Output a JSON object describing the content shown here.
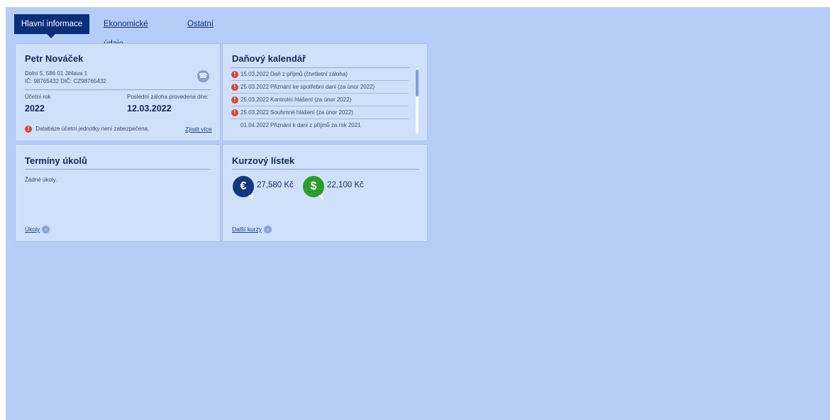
{
  "tabs": {
    "active": "Hlavní informace",
    "economic": "Ekonomické údaje",
    "other": "Ostatní"
  },
  "company": {
    "name": "Petr Nováček",
    "address": "Dolní 5, 586 01 Jihlava 1",
    "ids": "IČ: 98765432  DIČ: CZ98765432",
    "fiscal_year_label": "Účetní rok",
    "fiscal_year": "2022",
    "last_advance_label": "Poslední záloha provedena dne:",
    "last_advance_date": "12.03.2022",
    "warning_text": "Databáze účetní jednotky není zabezpečena.",
    "warning_link": "Zjistit více",
    "icon": "phone-icon"
  },
  "tax_calendar": {
    "title": "Daňový kalendář",
    "rows": [
      {
        "date": "15.03.2022",
        "text": "Daň z příjmů (čtvrtletní záloha)",
        "alert": true
      },
      {
        "date": "25.03.2022",
        "text": "Přiznání ke spotřební dani (za únor 2022)",
        "alert": true
      },
      {
        "date": "25.03.2022",
        "text": "Kontrolní hlášení (za únor 2022)",
        "alert": true
      },
      {
        "date": "25.03.2022",
        "text": "Souhrnné hlášení (za únor 2022)",
        "alert": true
      },
      {
        "date": "01.04.2022",
        "text": "Přiznání k dani z příjmů za rok 2021",
        "alert": false
      }
    ]
  },
  "tasks": {
    "title": "Termíny úkolů",
    "empty_text": "Žádné úkoly.",
    "link": "Úkoly"
  },
  "rates": {
    "title": "Kurzový lístek",
    "eur_symbol": "€",
    "eur": "27,580 Kč",
    "usd_symbol": "$",
    "usd": "22,100 Kč",
    "link": "Další kurzy",
    "colors": {
      "eur": "#12377e",
      "usd": "#2a9d2a"
    }
  },
  "colors": {
    "background": "#b6cef7",
    "panel": "#cfe0fb",
    "accent": "#0a2f7a",
    "alert": "#d8452b"
  }
}
